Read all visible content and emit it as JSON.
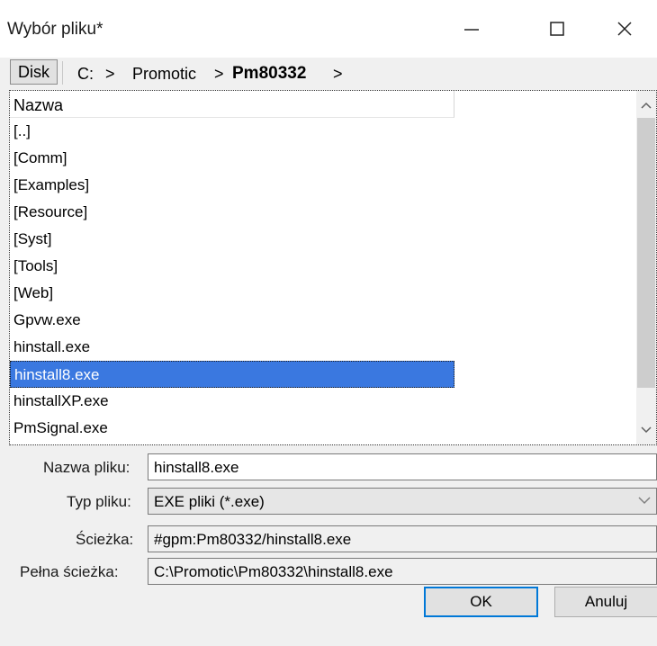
{
  "window": {
    "title": "Wybór pliku*"
  },
  "breadcrumb": {
    "disk_label": "Disk",
    "items": [
      "C:",
      ">",
      "Promotic",
      ">",
      "Pm80332",
      ">"
    ]
  },
  "list": {
    "header": "Nazwa",
    "items": [
      "[..]",
      "[Comm]",
      "[Examples]",
      "[Resource]",
      "[Syst]",
      "[Tools]",
      "[Web]",
      "Gpvw.exe",
      "hinstall.exe",
      "hinstall8.exe",
      "hinstallXP.exe",
      "PmSignal.exe"
    ],
    "selected_index": 9
  },
  "fields": {
    "filename": {
      "label": "Nazwa pliku:",
      "value": "hinstall8.exe"
    },
    "filetype": {
      "label": "Typ pliku:",
      "value": "EXE pliki (*.exe)"
    },
    "path": {
      "label": "Ścieżka:",
      "value": "#gpm:Pm80332/hinstall8.exe"
    },
    "fullpath": {
      "label": "Pełna ścieżka:",
      "value": "C:\\Promotic\\Pm80332\\hinstall8.exe"
    }
  },
  "buttons": {
    "ok": "OK",
    "cancel": "Anuluj"
  },
  "icons": {
    "minimize": "minimize-icon",
    "maximize": "maximize-icon",
    "close": "close-icon",
    "scroll_up": "chevron-up-icon",
    "scroll_down": "chevron-down-icon",
    "dropdown": "chevron-down-icon"
  },
  "colors": {
    "selection": "#3a78e0",
    "focus": "#0078d7"
  }
}
